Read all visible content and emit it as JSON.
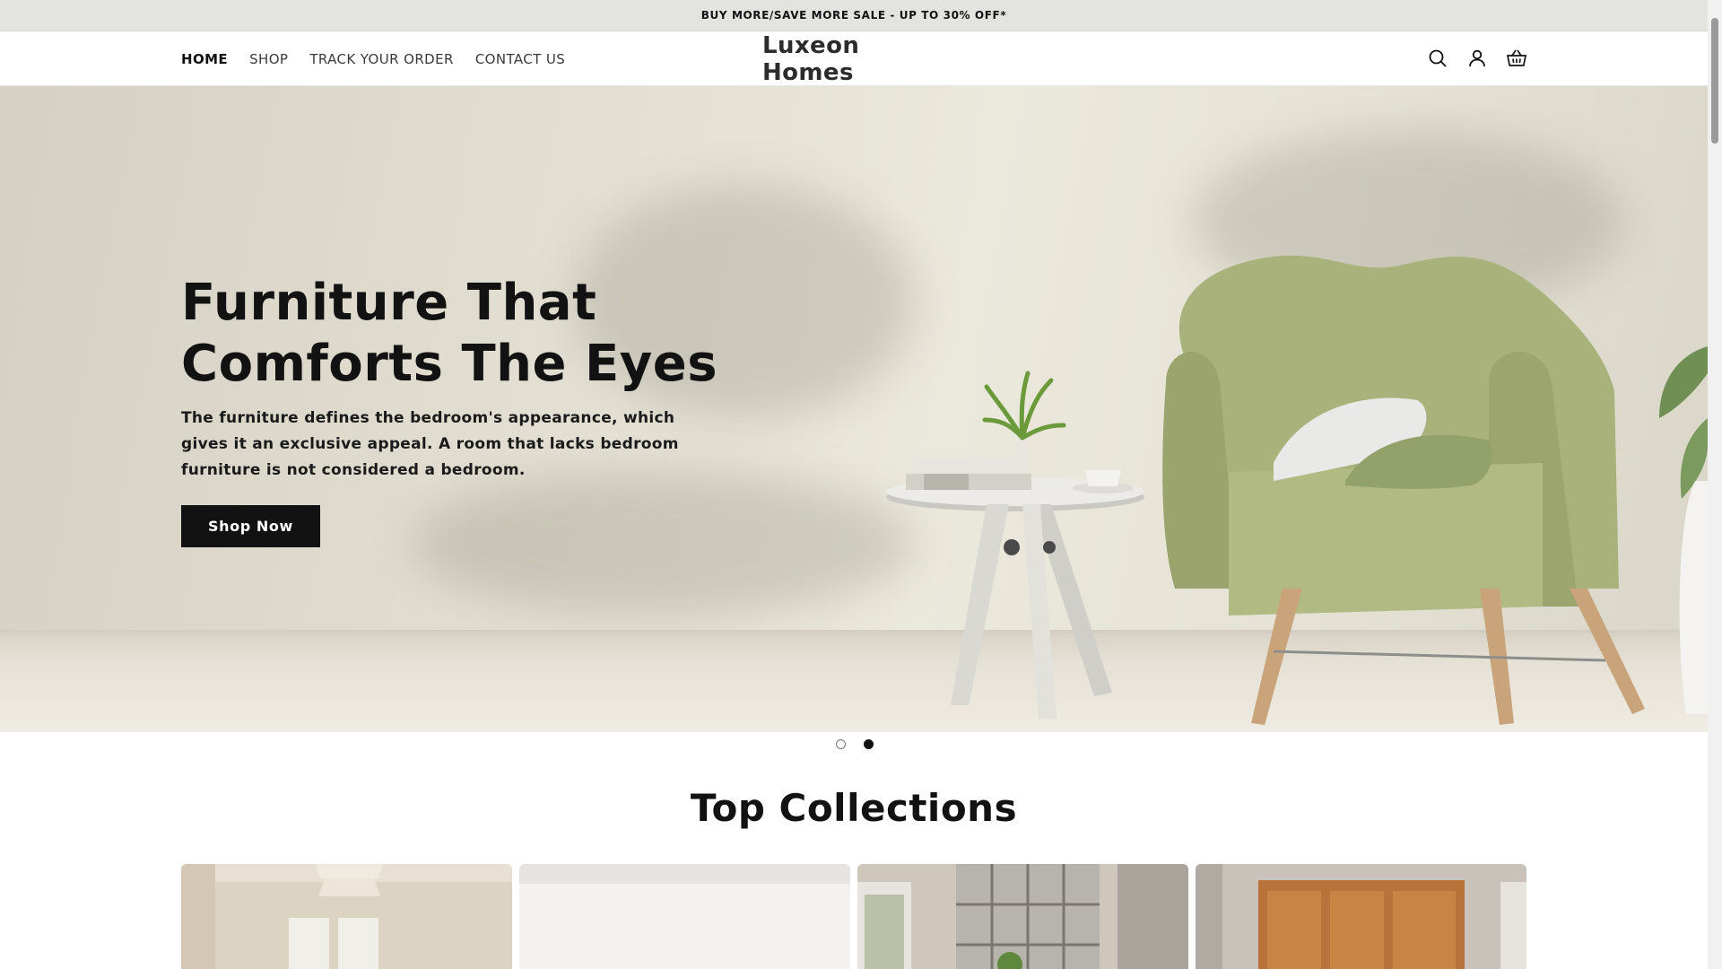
{
  "announcement": {
    "text": "BUY MORE/SAVE MORE SALE - UP TO 30% OFF*"
  },
  "header": {
    "nav": [
      {
        "label": "HOME",
        "active": true
      },
      {
        "label": "SHOP"
      },
      {
        "label": "TRACK YOUR ORDER"
      },
      {
        "label": "CONTACT US"
      }
    ],
    "logo": "Luxeon Homes",
    "icons": [
      "search-icon",
      "account-icon",
      "cart-icon"
    ]
  },
  "hero": {
    "title_line1": "Furniture That",
    "title_line2": "Comforts The Eyes",
    "text": "The furniture defines the bedroom's appearance, which gives it an exclusive appeal. A room that lacks bedroom furniture is not considered a bedroom.",
    "button": "Shop Now",
    "slides": 2,
    "active_slide": 2
  },
  "collections": {
    "title": "Top Collections",
    "items": 4
  },
  "colors": {
    "announcement_bg": "#e3e4df",
    "text": "#121212",
    "chair": "#a8b27a",
    "button_bg": "#121212"
  }
}
